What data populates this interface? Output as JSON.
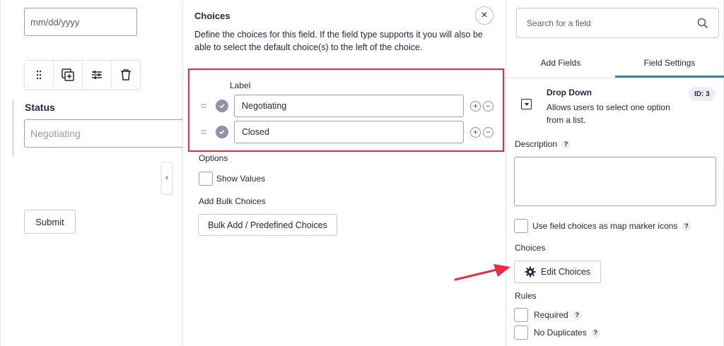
{
  "form": {
    "date_placeholder": "mm/dd/yyyy",
    "toolbar_icons": [
      "drag-handle-icon",
      "duplicate-icon",
      "settings-sliders-icon",
      "trash-icon"
    ],
    "status_label": "Status",
    "status_placeholder": "Negotiating",
    "collapse_glyph": "‹",
    "submit_label": "Submit"
  },
  "flyout": {
    "title": "Choices",
    "close_glyph": "×",
    "description": "Define the choices for this field. If the field type supports it you will also be able to select the default choice(s) to the left of the choice.",
    "label_column": "Label",
    "choices": [
      {
        "label": "Negotiating"
      },
      {
        "label": "Closed"
      }
    ],
    "add_glyph": "+",
    "remove_glyph": "−",
    "drag_glyph": "=",
    "options_heading": "Options",
    "show_values_label": "Show Values",
    "bulk_heading": "Add Bulk Choices",
    "bulk_button": "Bulk Add / Predefined Choices",
    "highlight_color": "#ea2b3f"
  },
  "sidebar": {
    "search_placeholder": "Search for a field",
    "tabs": [
      {
        "label": "Add Fields",
        "active": false
      },
      {
        "label": "Field Settings",
        "active": true
      }
    ],
    "field_type": "Drop Down",
    "field_type_desc": "Allows users to select one option from a list.",
    "field_id": "ID: 3",
    "description_label": "Description",
    "help_glyph": "?",
    "map_marker_label": "Use field choices as map marker icons",
    "choices_heading": "Choices",
    "edit_choices_button": "Edit Choices",
    "rules_heading": "Rules",
    "rules": [
      {
        "label": "Required"
      },
      {
        "label": "No Duplicates"
      }
    ]
  },
  "colors": {
    "text": "#242748",
    "accent_tab": "#3e7da6",
    "annotation_red": "#ea2b3f"
  }
}
